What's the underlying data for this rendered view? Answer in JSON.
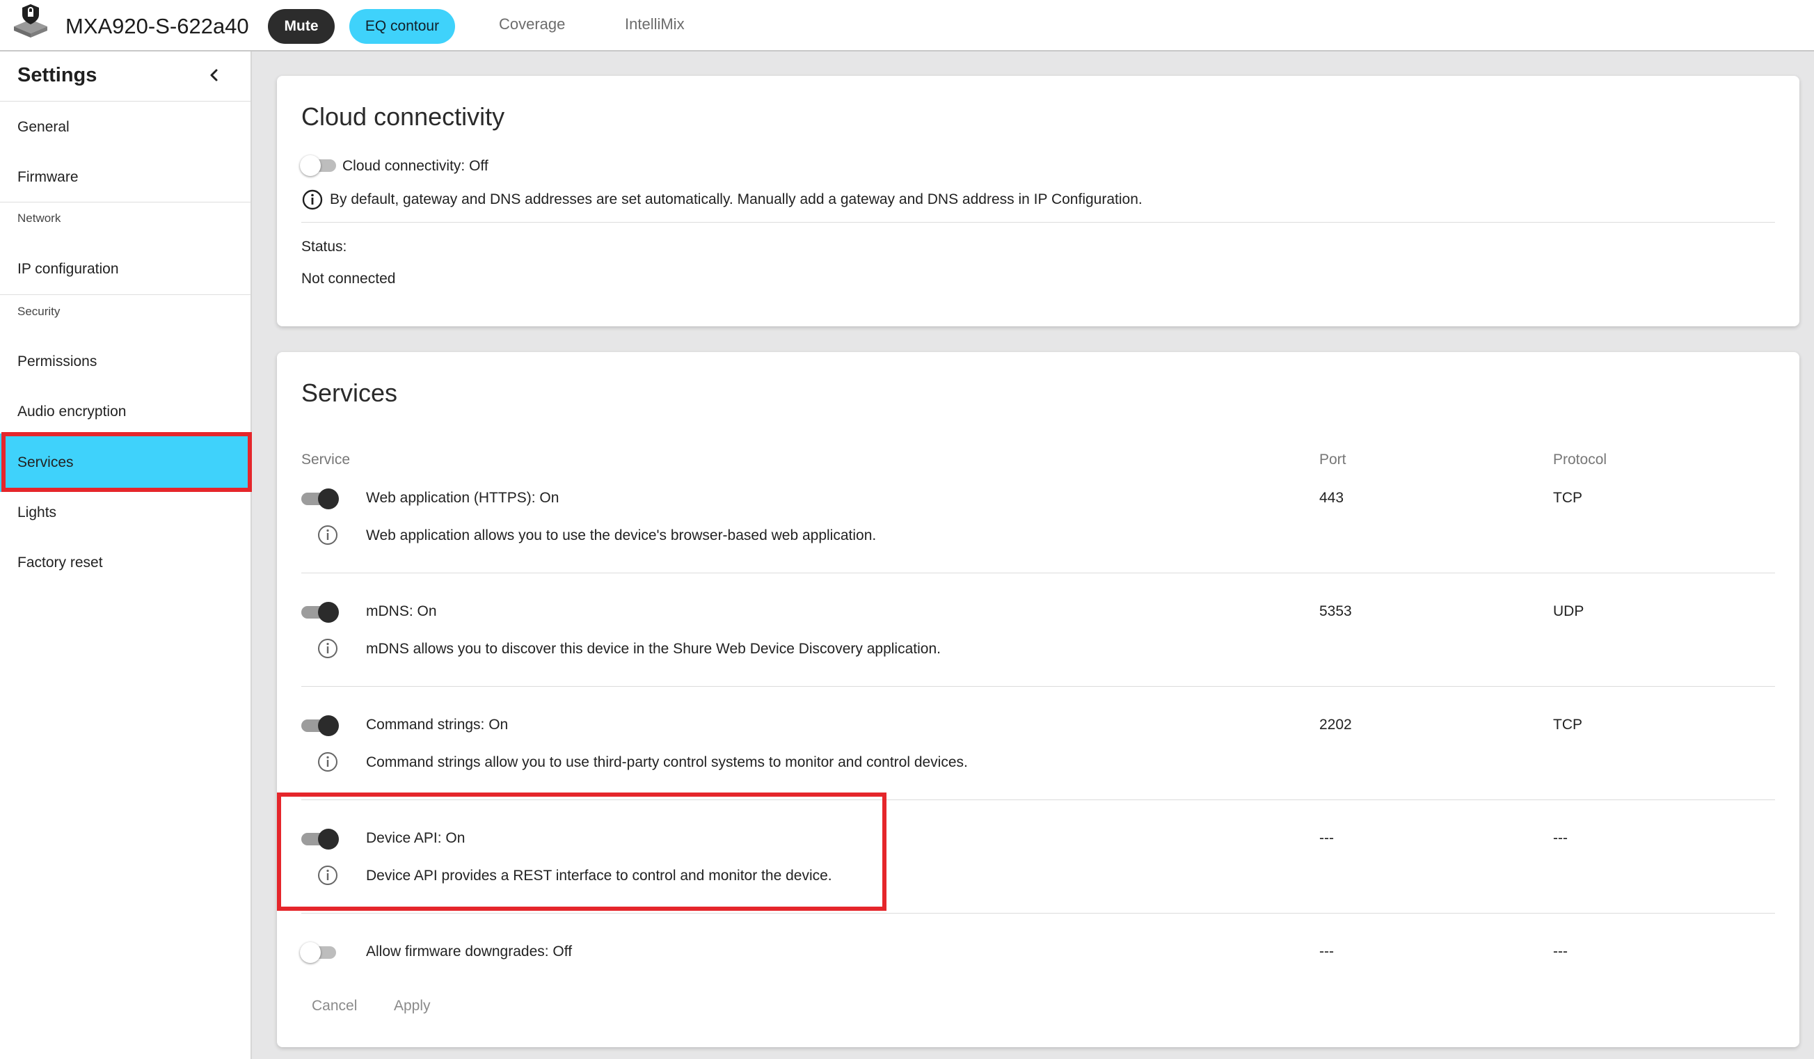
{
  "header": {
    "device_name": "MXA920-S-622a40",
    "mute_label": "Mute",
    "eq_label": "EQ contour",
    "tabs": [
      "Coverage",
      "IntelliMix"
    ]
  },
  "sidebar": {
    "title": "Settings",
    "items": {
      "general": "General",
      "firmware": "Firmware",
      "network_section": "Network",
      "ip_configuration": "IP configuration",
      "security_section": "Security",
      "permissions": "Permissions",
      "audio_encryption": "Audio encryption",
      "services": "Services",
      "lights": "Lights",
      "factory_reset": "Factory reset"
    },
    "active_item": "Services"
  },
  "cloud": {
    "title": "Cloud connectivity",
    "toggle_label": "Cloud connectivity: Off",
    "toggle_state": "off",
    "info_text": "By default, gateway and DNS addresses are set automatically. Manually add a gateway and DNS address in IP Configuration.",
    "status_label": "Status:",
    "status_value": "Not connected"
  },
  "services": {
    "title": "Services",
    "columns": {
      "service": "Service",
      "port": "Port",
      "protocol": "Protocol"
    },
    "rows": [
      {
        "label": "Web application (HTTPS): On",
        "state": "on",
        "description": "Web application allows you to use the device's browser-based web application.",
        "port": "443",
        "protocol": "TCP"
      },
      {
        "label": "mDNS: On",
        "state": "on",
        "description": "mDNS allows you to discover this device in the Shure Web Device Discovery application.",
        "port": "5353",
        "protocol": "UDP"
      },
      {
        "label": "Command strings: On",
        "state": "on",
        "description": "Command strings allow you to use third-party control systems to monitor and control devices.",
        "port": "2202",
        "protocol": "TCP"
      },
      {
        "label": "Device API: On",
        "state": "on",
        "description": "Device API provides a REST interface to control and monitor the device.",
        "port": "---",
        "protocol": "---"
      },
      {
        "label": "Allow firmware downgrades: Off",
        "state": "off",
        "port": "---",
        "protocol": "---"
      }
    ],
    "cancel_label": "Cancel",
    "apply_label": "Apply"
  },
  "colors": {
    "accent": "#3fd2fb",
    "highlight": "#e5262b",
    "dark": "#2b2b2b"
  }
}
